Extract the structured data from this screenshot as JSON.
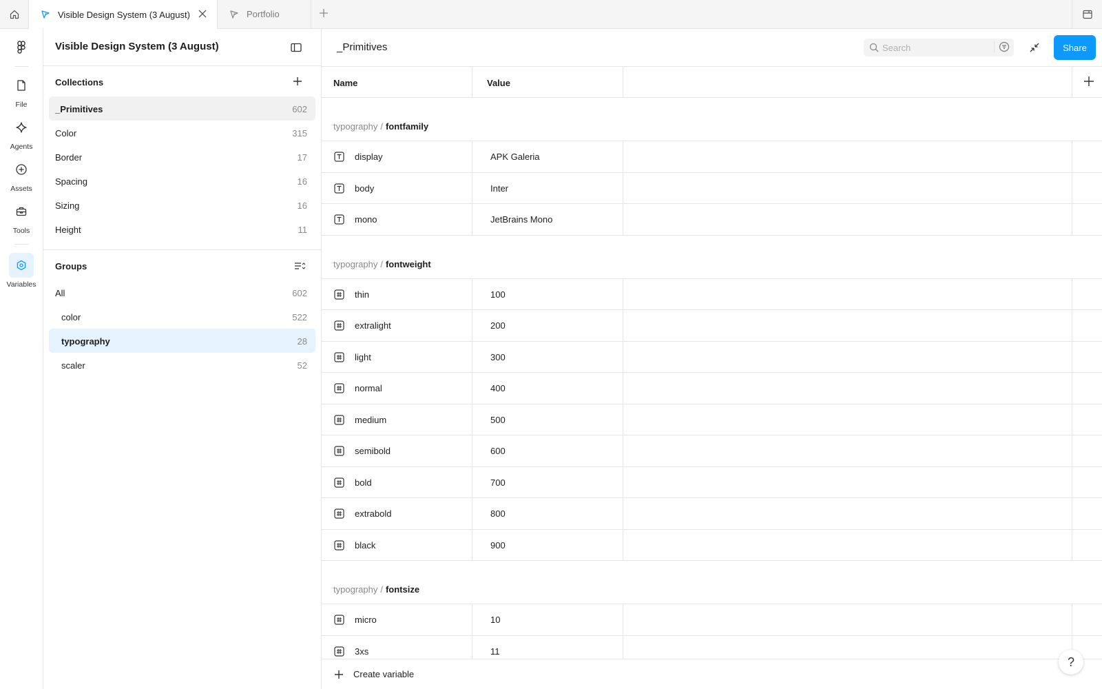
{
  "tabs": {
    "active_title": "Visible Design System (3 August)",
    "inactive_title": "Portfolio"
  },
  "rail": {
    "items": [
      {
        "label": "File"
      },
      {
        "label": "Agents"
      },
      {
        "label": "Assets"
      },
      {
        "label": "Tools"
      },
      {
        "label": "Variables"
      }
    ]
  },
  "side": {
    "title": "Visible Design System (3 August)",
    "collections_title": "Collections",
    "collections": [
      {
        "label": "_Primitives",
        "count": "602"
      },
      {
        "label": "Color",
        "count": "315"
      },
      {
        "label": "Border",
        "count": "17"
      },
      {
        "label": "Spacing",
        "count": "16"
      },
      {
        "label": "Sizing",
        "count": "16"
      },
      {
        "label": "Height",
        "count": "11"
      }
    ],
    "groups_title": "Groups",
    "groups": [
      {
        "label": "All",
        "count": "602"
      },
      {
        "label": "color",
        "count": "522"
      },
      {
        "label": "typography",
        "count": "28"
      },
      {
        "label": "scaler",
        "count": "52"
      }
    ]
  },
  "main": {
    "title": "_Primitives",
    "search_placeholder": "Search",
    "share_label": "Share",
    "col_name": "Name",
    "col_value": "Value",
    "group_parent": "typography",
    "group_sep": "/",
    "fontfamily": {
      "name": "fontfamily",
      "rows": [
        {
          "name": "display",
          "value": "APK Galeria"
        },
        {
          "name": "body",
          "value": "Inter"
        },
        {
          "name": "mono",
          "value": "JetBrains Mono"
        }
      ]
    },
    "fontweight": {
      "name": "fontweight",
      "rows": [
        {
          "name": "thin",
          "value": "100"
        },
        {
          "name": "extralight",
          "value": "200"
        },
        {
          "name": "light",
          "value": "300"
        },
        {
          "name": "normal",
          "value": "400"
        },
        {
          "name": "medium",
          "value": "500"
        },
        {
          "name": "semibold",
          "value": "600"
        },
        {
          "name": "bold",
          "value": "700"
        },
        {
          "name": "extrabold",
          "value": "800"
        },
        {
          "name": "black",
          "value": "900"
        }
      ]
    },
    "fontsize": {
      "name": "fontsize",
      "rows": [
        {
          "name": "micro",
          "value": "10"
        },
        {
          "name": "3xs",
          "value": "11"
        }
      ]
    },
    "create_label": "Create variable"
  },
  "help_label": "?",
  "colors": {
    "accent": "#0d99ff",
    "selected_bg": "#e5f3ff"
  }
}
